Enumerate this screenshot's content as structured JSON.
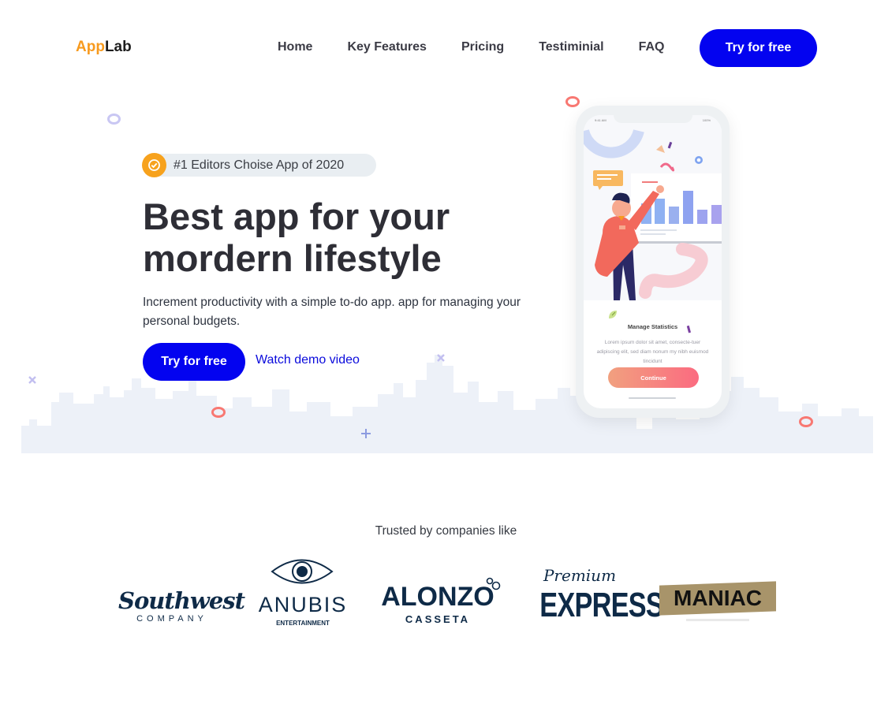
{
  "nav": {
    "logo_part1": "App",
    "logo_part2": "Lab",
    "links": [
      "Home",
      "Key Features",
      "Pricing",
      "Testiminial",
      "FAQ"
    ],
    "cta": "Try for free"
  },
  "hero": {
    "badge": "#1 Editors Choise App of 2020",
    "headline_line1": "Best app for your",
    "headline_line2": "mordern lifestyle",
    "subtext": "Increment productivity with a simple to-do app. app for managing your personal budgets.",
    "cta": "Try for free",
    "demo_link": "Watch demo video"
  },
  "phone": {
    "status_time": "9:41 AM",
    "status_right": "100%",
    "title": "Manage Statistics",
    "body": "Lorem ipsum dolor sit amet, consecte-tuer adipiscing elit, sed diam nonum my nibh euismod tincidunt",
    "button": "Continue"
  },
  "trusted": {
    "heading": "Trusted by companies like",
    "companies": [
      {
        "name": "Southwest",
        "sub": "COMPANY"
      },
      {
        "name": "ANUBIS",
        "sub": "ENTERTAINMENT"
      },
      {
        "name": "ALONZO",
        "sub": "CASSETA"
      },
      {
        "name": "EXPRESS",
        "sub": "Premium"
      },
      {
        "name": "MANIAC",
        "sub": ""
      }
    ]
  },
  "colors": {
    "brand_blue": "#0303f0",
    "accent_orange": "#f79a1e",
    "coral": "#fb6b80",
    "navy": "#0e2a47"
  }
}
